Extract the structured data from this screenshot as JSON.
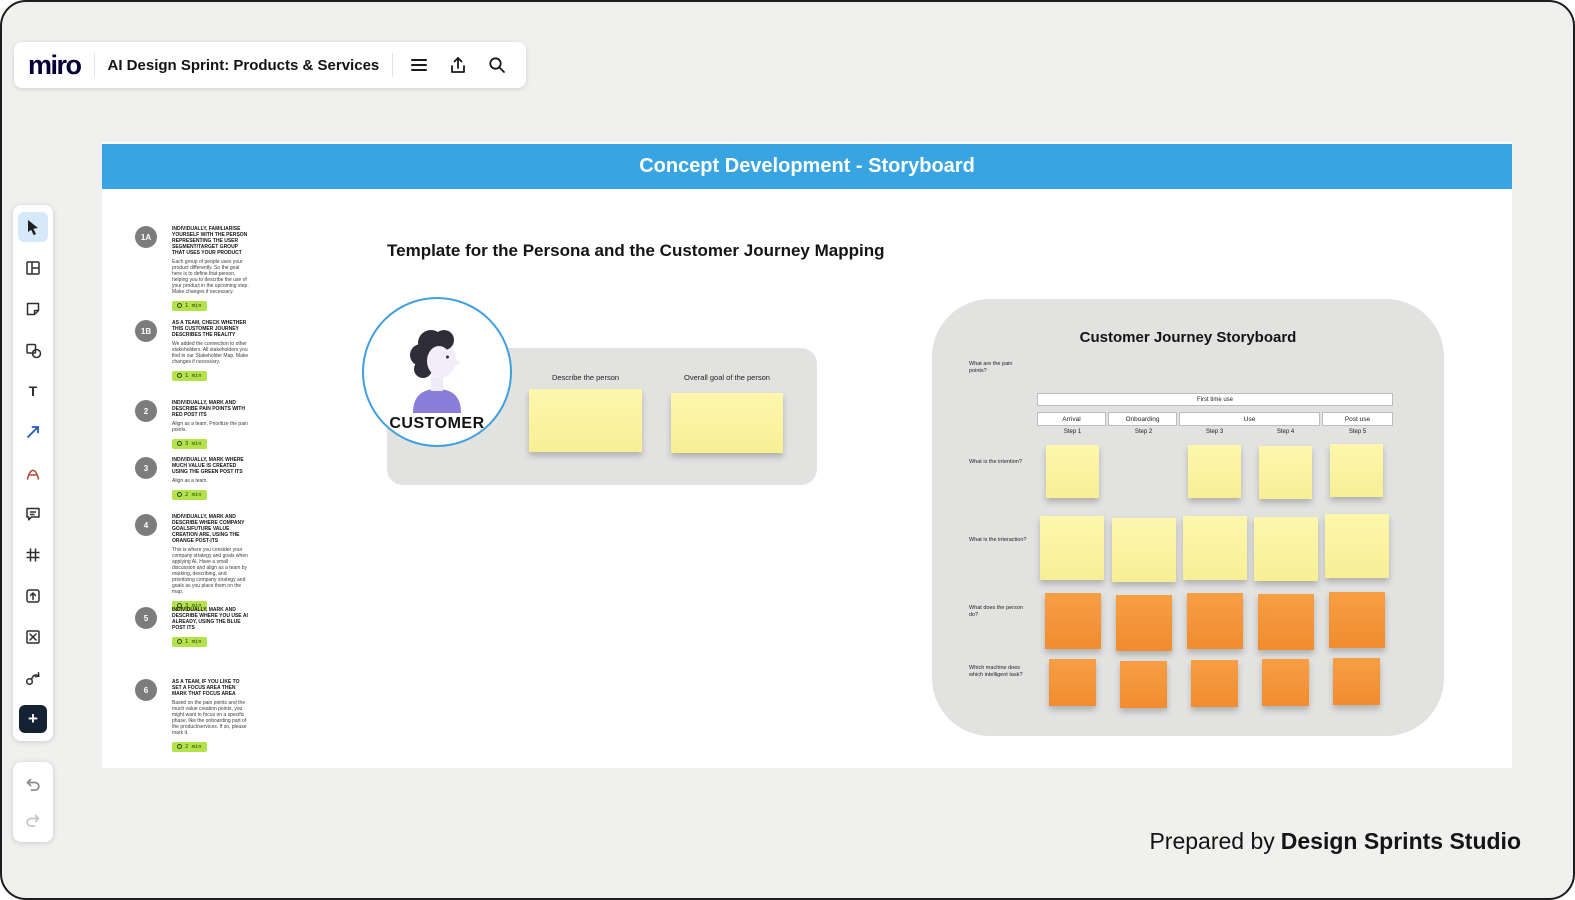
{
  "topbar": {
    "logo": "miro",
    "board_title": "AI Design Sprint: Products & Services"
  },
  "board": {
    "header": "Concept Development - Storyboard",
    "steps": [
      {
        "id": "1A",
        "heading": "Individually, familiarise yourself with the person representing the user segment/target group that uses your product",
        "body": "Each group of people uses your product differently. So the goal here is to define that person, helping you to describe the use of your product in the upcoming step. Make changes if necessary.",
        "time": "1 min"
      },
      {
        "id": "1B",
        "heading": "As a team, check whether this customer journey describes the reality",
        "body": "We added the connection to other stakeholders. All stakeholders you find in our Stakeholder Map. Make changes if necessary.",
        "time": "1 min"
      },
      {
        "id": "2",
        "heading": "Individually, mark and describe pain points with red post its",
        "body": "Align as a team. Prioritize the pain points.",
        "time": "3 min"
      },
      {
        "id": "3",
        "heading": "Individually, mark where much value is created using the green post its",
        "body": "Align as a team.",
        "time": "2 min"
      },
      {
        "id": "4",
        "heading": "Individually, mark and describe where company goals/future value creation are, using the orange post-its",
        "body": "This is where you consider your company strategy and goals when applying AI. Have a small discussion and align as a team by marking, describing, and prioritizing company strategy and goals as you place them on the map.",
        "time": "3 min"
      },
      {
        "id": "5",
        "heading": "Individually, mark and describe where you use AI already, using the blue post its",
        "body": "",
        "time": "1 min"
      },
      {
        "id": "6",
        "heading": "As a team, if you like to set a focus area then mark that focus area",
        "body": "Based on the pain points and the much value creation points, you might want to focus on a specific phase, like the onboarding part of the product/services. If so, please mark it.",
        "time": "2 min"
      }
    ],
    "persona": {
      "heading": "Template for the Persona and the Customer Journey Mapping",
      "avatar_label": "CUSTOMER",
      "describe_label": "Describe the person",
      "goal_label": "Overall goal of the person"
    },
    "storyboard": {
      "title": "Customer Journey Storyboard",
      "phase_header": "First time use",
      "phases": [
        "Arrival",
        "Onboarding",
        "Use",
        "Post use"
      ],
      "step_labels": [
        "Step 1",
        "Step 2",
        "Step 3",
        "Step 4",
        "Step 5"
      ],
      "row_labels": [
        "What are the pain points?",
        "What is the intention?",
        "What is the interaction?",
        "What does the person do?",
        "Which machine does which intelligent task?"
      ]
    },
    "credit_prefix": "Prepared by",
    "credit_name": "Design Sprints Studio"
  },
  "colors": {
    "header_blue": "#38a5e2",
    "sticky_yellow": "#fbf3a0",
    "sticky_orange": "#f6953c",
    "badge_green": "#b4e24d",
    "circle_border_blue": "#3f9fe0"
  }
}
